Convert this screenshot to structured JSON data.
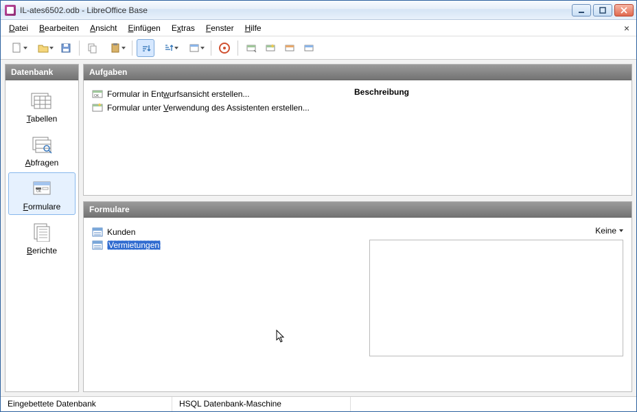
{
  "title": "IL-ates6502.odb - LibreOffice Base",
  "menu": [
    "Datei",
    "Bearbeiten",
    "Ansicht",
    "Einfügen",
    "Extras",
    "Fenster",
    "Hilfe"
  ],
  "menu_underline_idx": [
    0,
    0,
    0,
    0,
    1,
    0,
    0
  ],
  "sidebar": {
    "header": "Datenbank",
    "items": [
      {
        "label": "Tabellen"
      },
      {
        "label": "Abfragen"
      },
      {
        "label": "Formulare"
      },
      {
        "label": "Berichte"
      }
    ],
    "selected_index": 2
  },
  "tasks": {
    "header": "Aufgaben",
    "items": [
      "Formular in Entwurfsansicht erstellen...",
      "Formular unter Verwendung des Assistenten erstellen..."
    ],
    "task_underline_idx": [
      15,
      15
    ],
    "desc_title": "Beschreibung"
  },
  "objects": {
    "header": "Formulare",
    "items": [
      "Kunden",
      "Vermietungen"
    ],
    "selected_index": 1,
    "view_label": "Keine"
  },
  "status": {
    "left": "Eingebettete Datenbank",
    "engine": "HSQL Datenbank-Maschine"
  }
}
